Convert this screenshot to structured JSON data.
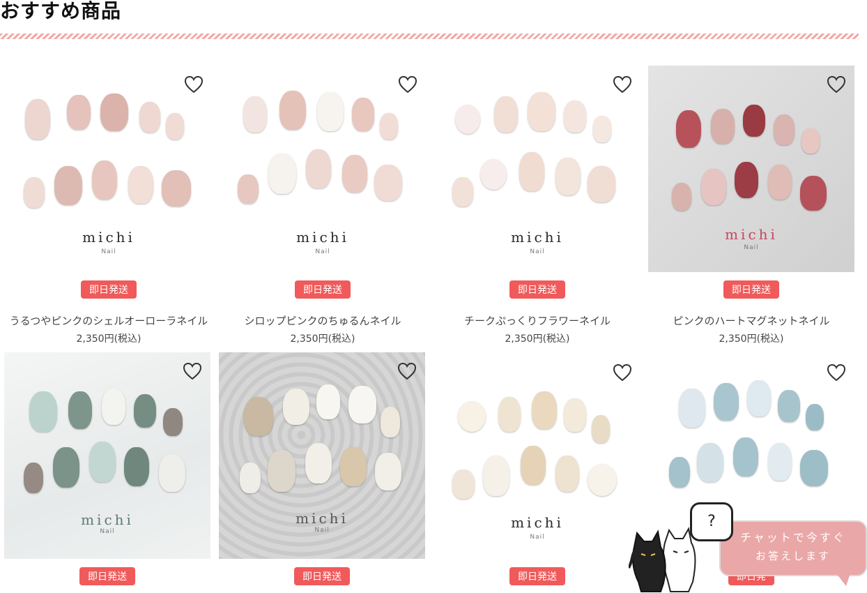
{
  "section": {
    "title": "おすすめ商品"
  },
  "products": [
    {
      "name": "うるつやピンクのシェルオーローラネイル",
      "price": "2,350円(税込)",
      "badge": "即日発送",
      "brand": "michi",
      "brand_sub": "Nail",
      "favorite_icon": "heart-outline-icon"
    },
    {
      "name": "シロップピンクのちゅるんネイル",
      "price": "2,350円(税込)",
      "badge": "即日発送",
      "brand": "michi",
      "brand_sub": "Nail",
      "favorite_icon": "heart-outline-icon"
    },
    {
      "name": "チークぷっくりフラワーネイル",
      "price": "2,350円(税込)",
      "badge": "即日発送",
      "brand": "michi",
      "brand_sub": "Nail",
      "favorite_icon": "heart-outline-icon"
    },
    {
      "name": "ピンクのハートマグネットネイル",
      "price": "2,350円(税込)",
      "badge": "即日発送",
      "brand": "michi",
      "brand_sub": "Nail",
      "favorite_icon": "heart-outline-icon"
    },
    {
      "badge": "即日発送",
      "brand": "michi",
      "brand_sub": "Nail",
      "favorite_icon": "heart-outline-icon"
    },
    {
      "badge": "即日発送",
      "brand": "michi",
      "brand_sub": "Nail",
      "favorite_icon": "heart-outline-icon"
    },
    {
      "badge": "即日発送",
      "brand": "michi",
      "brand_sub": "Nail",
      "favorite_icon": "heart-outline-icon"
    },
    {
      "badge": "即日発",
      "favorite_icon": "heart-outline-icon"
    }
  ],
  "chat": {
    "line1": "チャットで今すぐ",
    "line2": "お答えします",
    "question_mark": "?"
  },
  "colors": {
    "badge": "#f05a5a",
    "chat_bubble": "#eaa7a7",
    "rule": "#f2a8a8"
  }
}
